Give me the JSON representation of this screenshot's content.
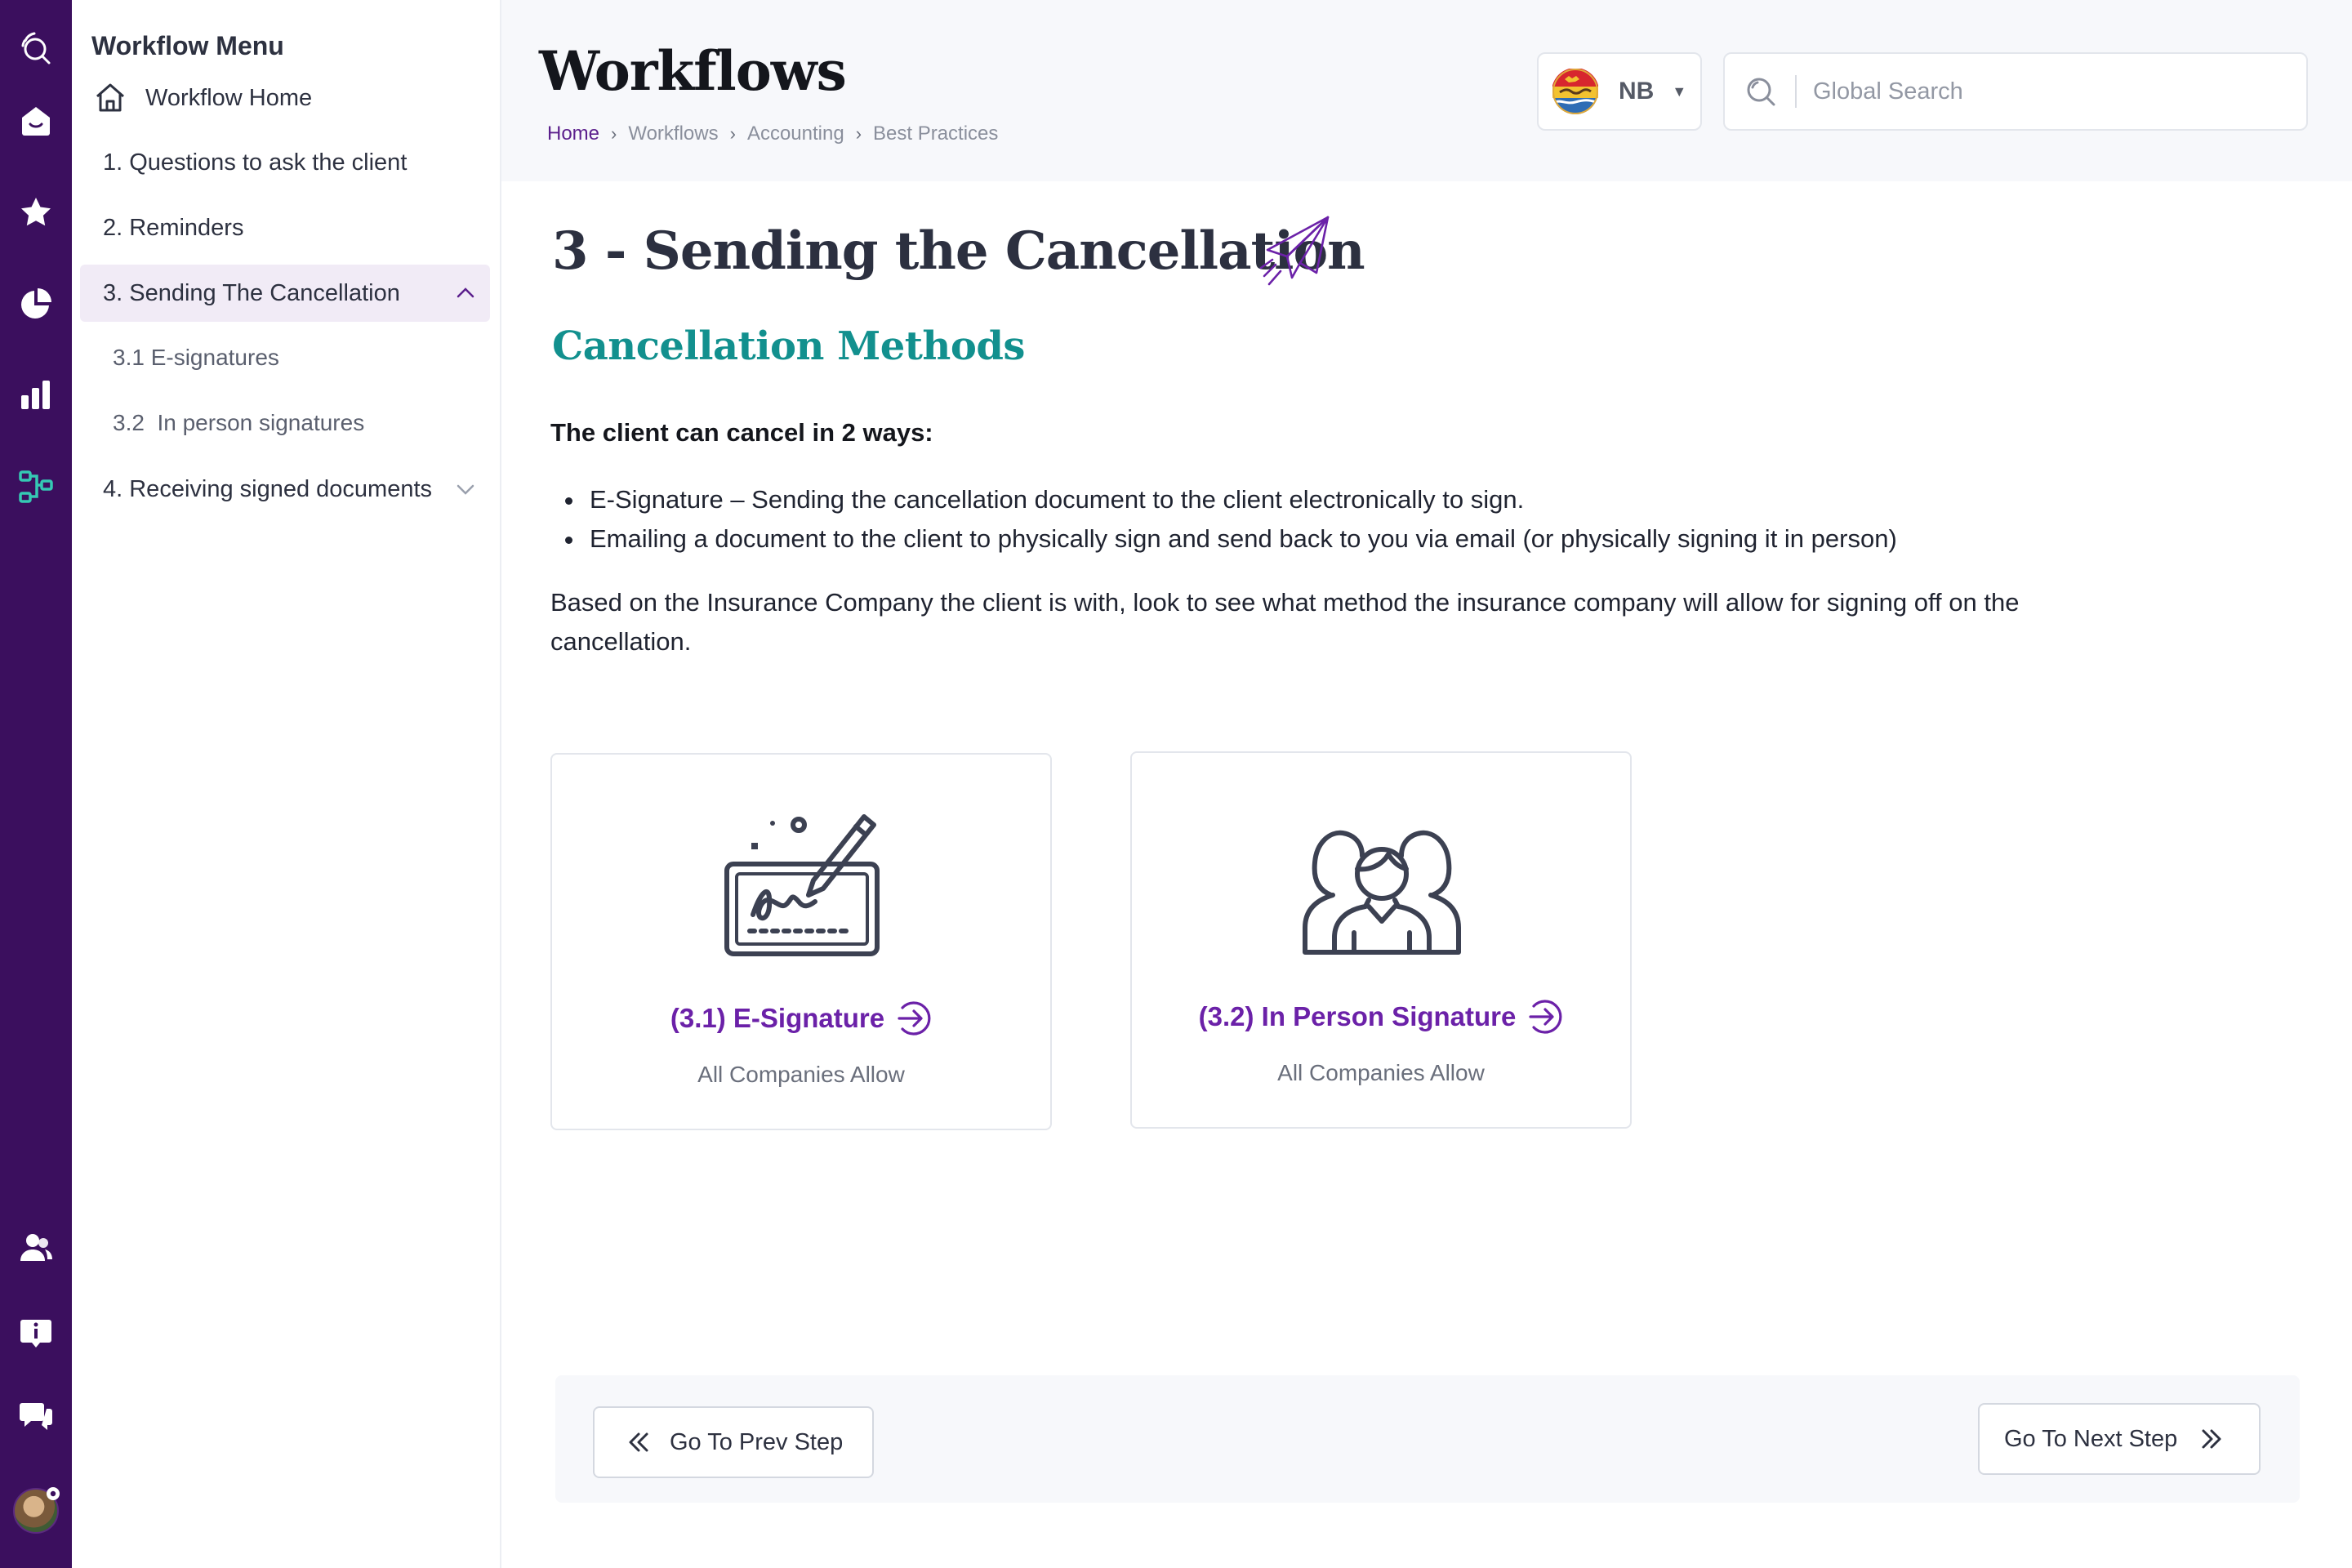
{
  "colors": {
    "rail": "#3b0f5e",
    "accent_purple": "#6b21a8",
    "teal": "#12908e",
    "active_menu_bg": "#f1ebf6"
  },
  "rail": {
    "icons": [
      "search-icon",
      "home-icon",
      "star-icon",
      "pie-chart-icon",
      "bar-chart-icon",
      "workflow-icon",
      "users-icon",
      "info-icon",
      "chat-icon"
    ]
  },
  "menu": {
    "title": "Workflow Menu",
    "home_label": "Workflow Home",
    "items": [
      {
        "label": "1. Questions to ask the client"
      },
      {
        "label": "2. Reminders"
      },
      {
        "label": "3. Sending The Cancellation",
        "expanded": true,
        "active": true
      },
      {
        "label": "4. Receiving signed documents",
        "expanded": false
      }
    ],
    "subitems": [
      {
        "label": "3.1 E-signatures"
      },
      {
        "label": "3.2  In person signatures"
      }
    ]
  },
  "header": {
    "title": "Workflows",
    "breadcrumb": [
      "Home",
      "Workflows",
      "Accounting",
      "Best Practices"
    ],
    "province_code": "NB",
    "search_placeholder": "Global Search"
  },
  "content": {
    "title": "3 - Sending the Cancellation",
    "subheading": "Cancellation Methods",
    "lead": "The client can cancel in 2 ways:",
    "bullets": [
      "E-Signature – Sending the cancellation document to the client electronically to sign.",
      "Emailing a document to the client to physically sign and send back to you via email (or physically signing it in person)"
    ],
    "paragraph": "Based on the Insurance Company the client is with, look to see what method the insurance company will allow for signing off on the cancellation.",
    "cards": [
      {
        "title": "(3.1) E-Signature",
        "subtitle": "All Companies Allow",
        "icon": "signature-tablet-icon"
      },
      {
        "title": "(3.2) In Person Signature",
        "subtitle": "All Companies Allow",
        "icon": "people-group-icon"
      }
    ]
  },
  "footer": {
    "prev_label": "Go To Prev Step",
    "next_label": "Go To Next Step"
  }
}
